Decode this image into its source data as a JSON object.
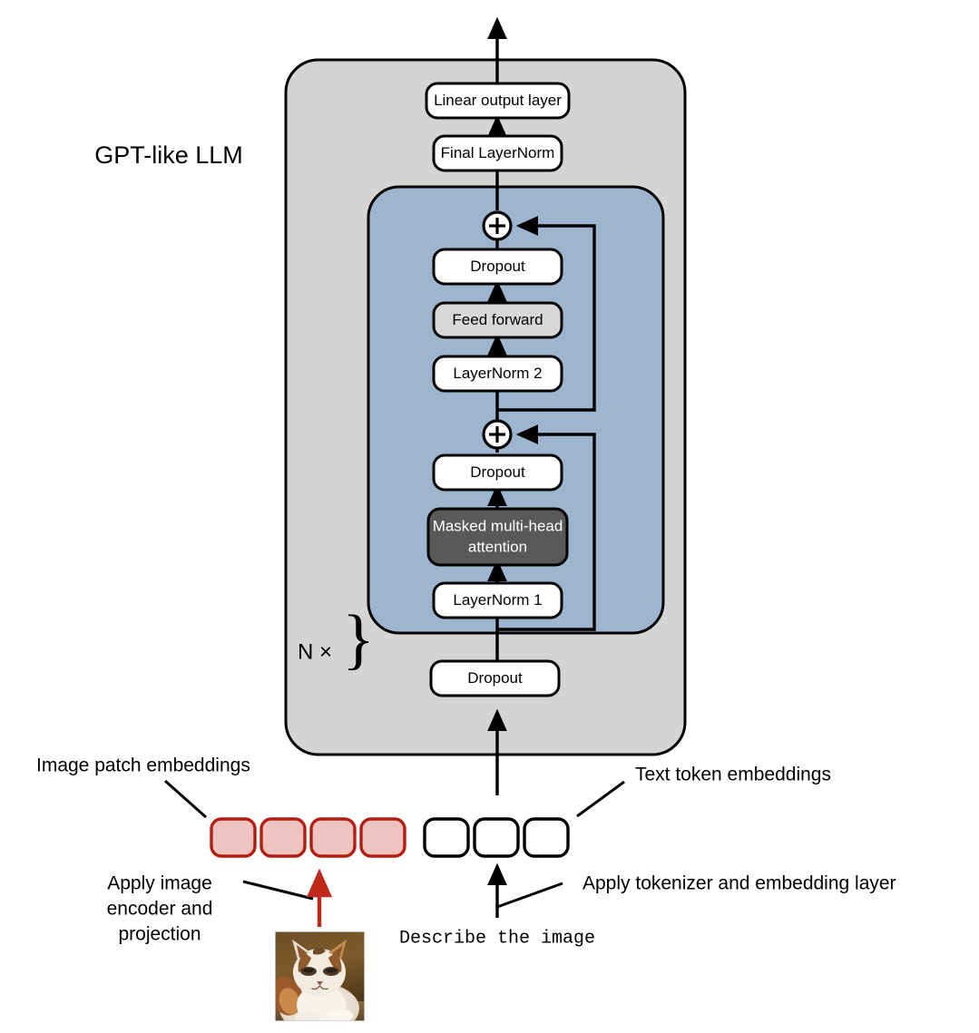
{
  "diagram": {
    "title": "GPT-like LLM",
    "repeat_label": "N ×",
    "outer_container_name": "gpt-like-llm-container",
    "transformer_block_name": "transformer-block",
    "colors": {
      "outer_box_fill": "#D4D4D4",
      "transformer_block_fill": "#9EB5D0",
      "plain_box_fill": "#FFFFFF",
      "shaded_box_fill": "#D8D8D8",
      "dark_box_fill": "#595959",
      "dark_box_text": "#FFFFFF",
      "stroke": "#000000",
      "patch_fill": "#EFC4C0",
      "patch_stroke": "#B31E10",
      "red_arrow": "#C1291A"
    },
    "blocks": [
      {
        "id": "linear-output-layer",
        "label": "Linear output layer",
        "style": "plain"
      },
      {
        "id": "final-layernorm",
        "label": "Final LayerNorm",
        "style": "plain"
      },
      {
        "id": "dropout-top",
        "label": "Dropout",
        "style": "plain"
      },
      {
        "id": "feed-forward",
        "label": "Feed forward",
        "style": "shaded"
      },
      {
        "id": "layernorm-2",
        "label": "LayerNorm 2",
        "style": "plain"
      },
      {
        "id": "dropout-mid",
        "label": "Dropout",
        "style": "plain"
      },
      {
        "id": "masked-multi-head-attention",
        "label_line1": "Masked multi-head",
        "label_line2": "attention",
        "style": "dark"
      },
      {
        "id": "layernorm-1",
        "label": "LayerNorm 1",
        "style": "plain"
      },
      {
        "id": "dropout-bottom",
        "label": "Dropout",
        "style": "plain"
      }
    ],
    "residual_symbol": "+",
    "annotations": {
      "image_patch_embeddings": "Image patch embeddings",
      "text_token_embeddings": "Text token embeddings",
      "apply_image_encoder_line1": "Apply image",
      "apply_image_encoder_line2": "encoder and",
      "apply_image_encoder_line3": "projection",
      "apply_tokenizer": "Apply tokenizer and embedding layer",
      "prompt_text": "Describe the image"
    },
    "embeddings": {
      "image_patch_count": 4,
      "text_token_count": 3
    },
    "input_image": {
      "name": "cat-photo",
      "description": "Calico cat photograph"
    }
  }
}
